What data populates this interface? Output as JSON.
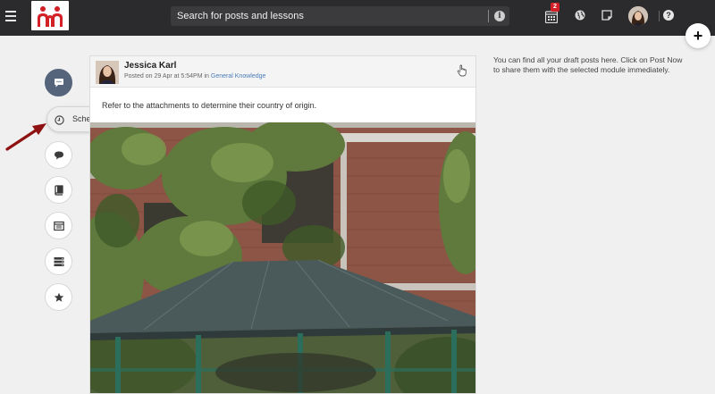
{
  "search": {
    "placeholder": "Search for posts and lessons"
  },
  "topbar": {
    "calendar_badge": "2"
  },
  "fab": {
    "label": "+"
  },
  "tooltip": {
    "label": "Scheduled Posts"
  },
  "post": {
    "author": "Jessica Karl",
    "posted_prefix": "Posted on 29 Apr at 5:54PM in ",
    "module": "General Knowledge",
    "text": "Refer to the attachments to determine their country of origin."
  },
  "side_note": {
    "text": "You can find all your draft posts here. Click on Post Now to share them with the selected module immediately."
  },
  "icons": [
    "hamburger-icon",
    "logo-icon",
    "info-icon",
    "calendar-icon",
    "globe-icon",
    "note-icon",
    "help-icon",
    "chat-icon",
    "clock-icon",
    "book-icon",
    "window-icon",
    "stack-icon",
    "star-icon",
    "hand-icon",
    "arrow-icon"
  ],
  "colors": {
    "topbar": "#2b2b2d",
    "accent": "#d32027",
    "rail_active": "#55647a",
    "link": "#4a7db8"
  }
}
